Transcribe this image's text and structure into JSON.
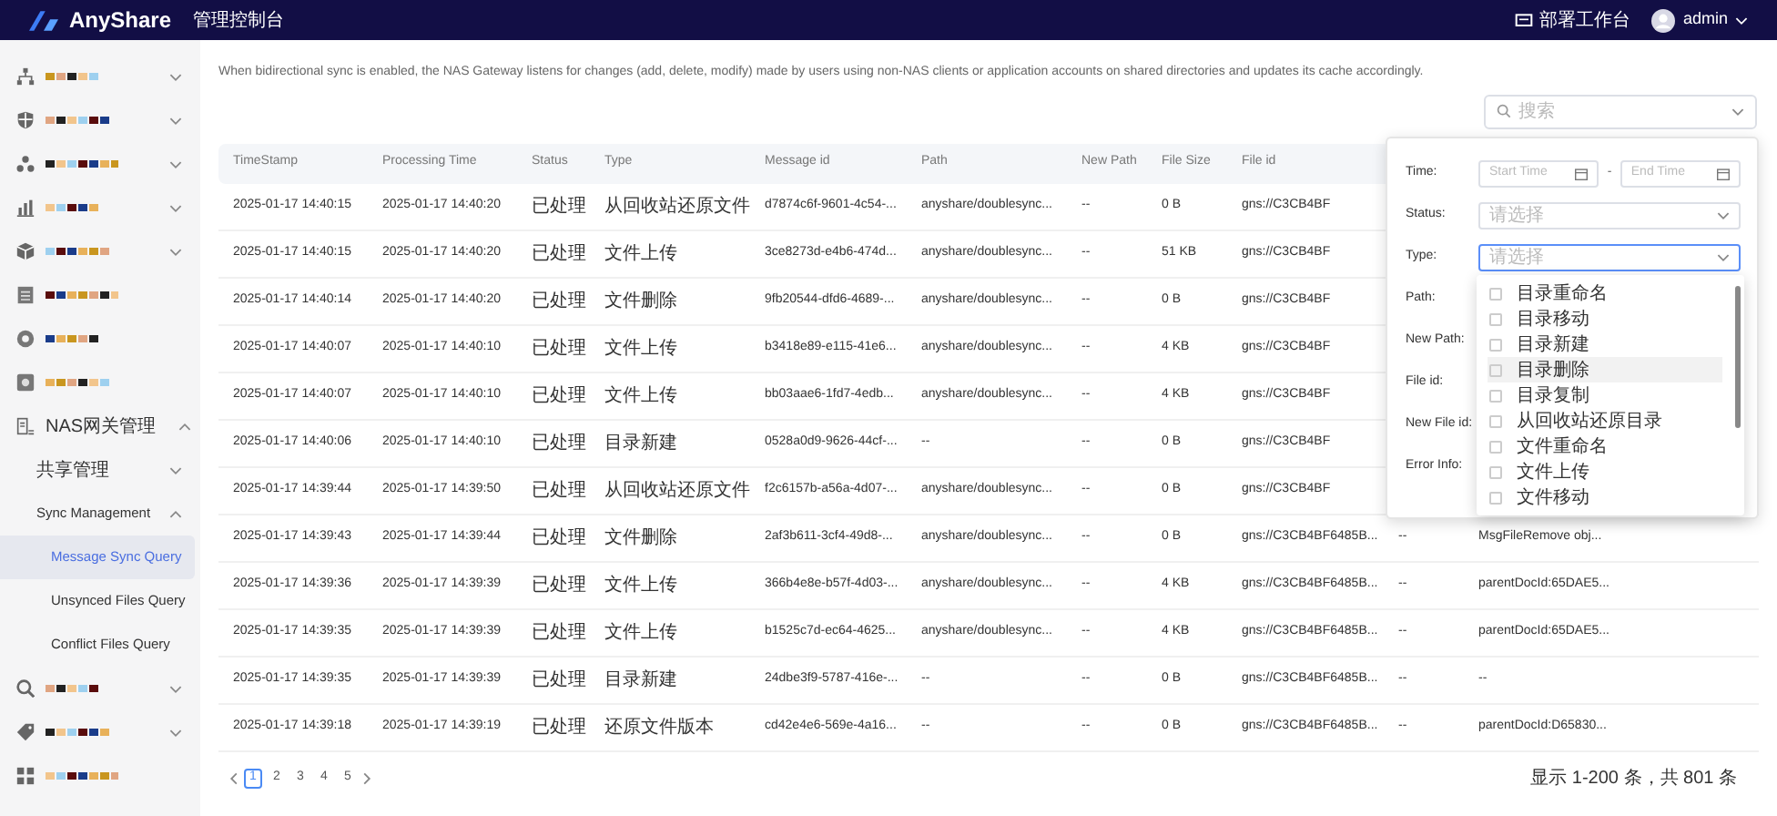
{
  "top_bar": {
    "logo": "AnyShare",
    "console": "管理控制台",
    "workbench": "部署工作台",
    "user": "admin"
  },
  "sidebar": {
    "items": [
      {
        "kind": "redacted",
        "expanded": false
      },
      {
        "kind": "redacted",
        "expanded": false
      },
      {
        "kind": "redacted",
        "expanded": false
      },
      {
        "kind": "redacted",
        "expanded": false
      },
      {
        "kind": "redacted",
        "expanded": false
      },
      {
        "kind": "redacted_link"
      },
      {
        "kind": "redacted_link"
      },
      {
        "kind": "redacted_link"
      },
      {
        "kind": "group",
        "label": "NAS网关管理",
        "expanded": true,
        "children": [
          {
            "label": "共享管理",
            "expanded": false
          },
          {
            "label": "Sync Management",
            "expanded": true,
            "children": [
              {
                "label": "Message Sync Query",
                "selected": true
              },
              {
                "label": "Unsynced Files Query",
                "selected": false
              },
              {
                "label": "Conflict Files Query",
                "selected": false
              }
            ]
          }
        ]
      },
      {
        "kind": "redacted",
        "expanded": false
      },
      {
        "kind": "redacted",
        "expanded": false
      },
      {
        "kind": "redacted_link"
      }
    ]
  },
  "description": "When bidirectional sync is enabled, the NAS Gateway listens for changes (add, delete, modify) made by users using non-NAS clients or application accounts on shared directories and updates its cache accordingly.",
  "search": {
    "placeholder": "搜索"
  },
  "table": {
    "columns": [
      "TimeStamp",
      "Processing Time",
      "Status",
      "Type",
      "Message id",
      "Path",
      "New Path",
      "File Size",
      "File id"
    ],
    "rows": [
      [
        "2025-01-17 14:40:15",
        "2025-01-17 14:40:20",
        "已处理",
        "从回收站还原文件",
        "d7874c6f-9601-4c54-...",
        "anyshare/doublesync...",
        "--",
        "0 B",
        "gns://C3CB4BF"
      ],
      [
        "2025-01-17 14:40:15",
        "2025-01-17 14:40:20",
        "已处理",
        "文件上传",
        "3ce8273d-e4b6-474d...",
        "anyshare/doublesync...",
        "--",
        "51 KB",
        "gns://C3CB4BF"
      ],
      [
        "2025-01-17 14:40:14",
        "2025-01-17 14:40:20",
        "已处理",
        "文件删除",
        "9fb20544-dfd6-4689-...",
        "anyshare/doublesync...",
        "--",
        "0 B",
        "gns://C3CB4BF"
      ],
      [
        "2025-01-17 14:40:07",
        "2025-01-17 14:40:10",
        "已处理",
        "文件上传",
        "b3418e89-e115-41e6...",
        "anyshare/doublesync...",
        "--",
        "4 KB",
        "gns://C3CB4BF"
      ],
      [
        "2025-01-17 14:40:07",
        "2025-01-17 14:40:10",
        "已处理",
        "文件上传",
        "bb03aae6-1fd7-4edb...",
        "anyshare/doublesync...",
        "--",
        "4 KB",
        "gns://C3CB4BF"
      ],
      [
        "2025-01-17 14:40:06",
        "2025-01-17 14:40:10",
        "已处理",
        "目录新建",
        "0528a0d9-9626-44cf-...",
        "--",
        "--",
        "0 B",
        "gns://C3CB4BF"
      ],
      [
        "2025-01-17 14:39:44",
        "2025-01-17 14:39:50",
        "已处理",
        "从回收站还原文件",
        "f2c6157b-a56a-4d07-...",
        "anyshare/doublesync...",
        "--",
        "0 B",
        "gns://C3CB4BF"
      ],
      [
        "2025-01-17 14:39:43",
        "2025-01-17 14:39:44",
        "已处理",
        "文件删除",
        "2af3b611-3cf4-49d8-...",
        "anyshare/doublesync...",
        "--",
        "0 B",
        "gns://C3CB4BF6485B...",
        "--",
        "MsgFileRemove obj..."
      ],
      [
        "2025-01-17 14:39:36",
        "2025-01-17 14:39:39",
        "已处理",
        "文件上传",
        "366b4e8e-b57f-4d03-...",
        "anyshare/doublesync...",
        "--",
        "4 KB",
        "gns://C3CB4BF6485B...",
        "--",
        "parentDocId:65DAE5..."
      ],
      [
        "2025-01-17 14:39:35",
        "2025-01-17 14:39:39",
        "已处理",
        "文件上传",
        "b1525c7d-ec64-4625...",
        "anyshare/doublesync...",
        "--",
        "4 KB",
        "gns://C3CB4BF6485B...",
        "--",
        "parentDocId:65DAE5..."
      ],
      [
        "2025-01-17 14:39:35",
        "2025-01-17 14:39:39",
        "已处理",
        "目录新建",
        "24dbe3f9-5787-416e-...",
        "--",
        "--",
        "0 B",
        "gns://C3CB4BF6485B...",
        "--",
        "--"
      ],
      [
        "2025-01-17 14:39:18",
        "2025-01-17 14:39:19",
        "已处理",
        "还原文件版本",
        "cd42e4e6-569e-4a16...",
        "--",
        "--",
        "0 B",
        "gns://C3CB4BF6485B...",
        "--",
        "parentDocId:D65830..."
      ]
    ]
  },
  "filter_panel": {
    "fields": [
      {
        "label": "Time:",
        "kind": "range",
        "start_placeholder": "Start Time",
        "separator": "-",
        "end_placeholder": "End Time"
      },
      {
        "label": "Status:",
        "kind": "select",
        "placeholder": "请选择",
        "focused": false
      },
      {
        "label": "Type:",
        "kind": "select",
        "placeholder": "请选择",
        "focused": true
      },
      {
        "label": "Path:",
        "kind": "covered"
      },
      {
        "label": "New Path:",
        "kind": "covered"
      },
      {
        "label": "File id:",
        "kind": "covered"
      },
      {
        "label": "New File id:",
        "kind": "covered"
      },
      {
        "label": "Error Info:",
        "kind": "covered"
      }
    ],
    "dropdown": [
      {
        "label": "目录重命名",
        "checked": false,
        "highlighted": false
      },
      {
        "label": "目录移动",
        "checked": false,
        "highlighted": false
      },
      {
        "label": "目录新建",
        "checked": false,
        "highlighted": false
      },
      {
        "label": "目录删除",
        "checked": false,
        "highlighted": true
      },
      {
        "label": "目录复制",
        "checked": false,
        "highlighted": false
      },
      {
        "label": "从回收站还原目录",
        "checked": false,
        "highlighted": false
      },
      {
        "label": "文件重命名",
        "checked": false,
        "highlighted": false
      },
      {
        "label": "文件上传",
        "checked": false,
        "highlighted": false
      },
      {
        "label": "文件移动",
        "checked": false,
        "highlighted": false
      }
    ]
  },
  "pagination": {
    "pages": [
      {
        "label": "1",
        "selected": true
      },
      {
        "label": "2",
        "selected": false
      },
      {
        "label": "3",
        "selected": false
      },
      {
        "label": "4",
        "selected": false
      },
      {
        "label": "5",
        "selected": false
      }
    ],
    "summary": "显示 1-200 条，共 801 条"
  }
}
